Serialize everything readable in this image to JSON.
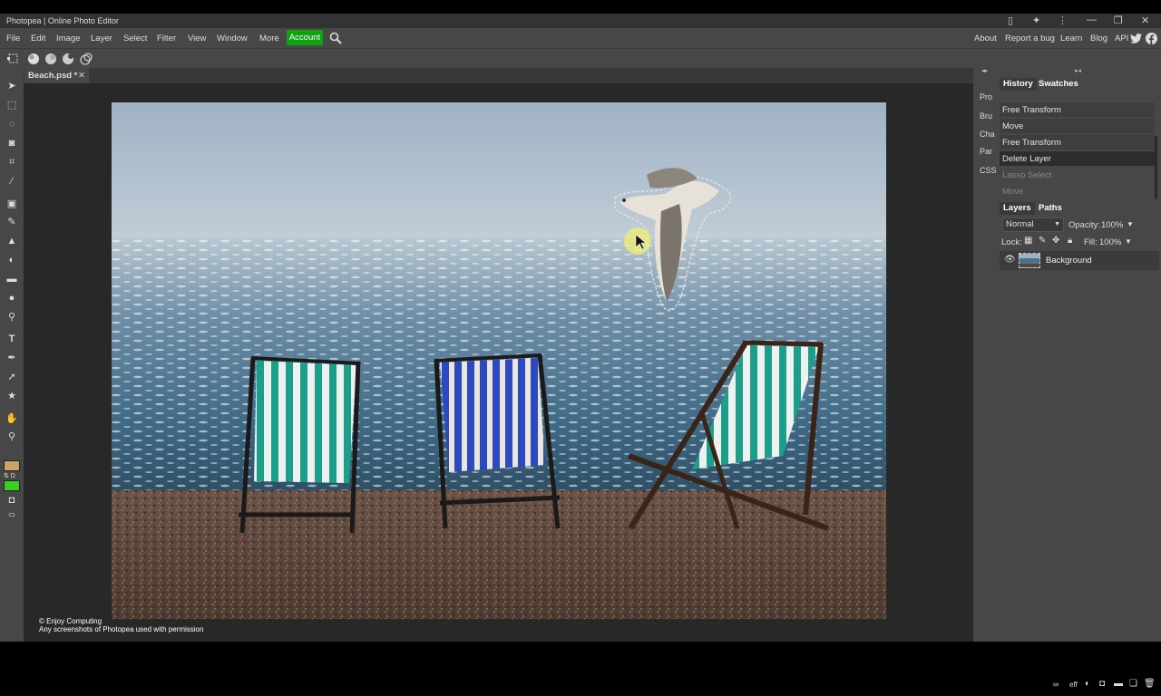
{
  "window": {
    "title": "Photopea | Online Photo Editor",
    "controls": [
      "▯",
      "✦",
      "⋮",
      "—",
      "❐",
      "✕"
    ]
  },
  "menu": {
    "items": [
      "File",
      "Edit",
      "Image",
      "Layer",
      "Select",
      "Filter",
      "View",
      "Window",
      "More"
    ],
    "account": "Account",
    "right": [
      "About",
      "Report a bug",
      "Learn",
      "Blog",
      "API"
    ]
  },
  "document": {
    "tab": "Beach.psd *",
    "close": "✕"
  },
  "mini_panels": [
    "Pro",
    "Bru",
    "Cha",
    "Par",
    "CSS"
  ],
  "history_panel": {
    "tabs": [
      "History",
      "Swatches"
    ],
    "steps": [
      {
        "label": "Free Transform",
        "state": "done"
      },
      {
        "label": "Move",
        "state": "done"
      },
      {
        "label": "Free Transform",
        "state": "done"
      },
      {
        "label": "Delete Layer",
        "state": "current"
      },
      {
        "label": "Lasso Select",
        "state": "undone"
      },
      {
        "label": "Move",
        "state": "undone"
      }
    ]
  },
  "layers_panel": {
    "tabs": [
      "Layers",
      "Paths"
    ],
    "blend_mode": "Normal",
    "opacity_label": "Opacity:",
    "opacity": "100%",
    "lock_label": "Lock:",
    "fill_label": "Fill:",
    "fill": "100%",
    "layers": [
      {
        "name": "Background",
        "visible": true
      }
    ]
  },
  "canvas": {
    "copyright_line1": "© Enjoy Computing",
    "copyright_line2": "Any screenshots of Photopea used with permission"
  },
  "colors": {
    "foreground": "#c9a464",
    "background": "#39d11a",
    "accent": "#11a211"
  }
}
